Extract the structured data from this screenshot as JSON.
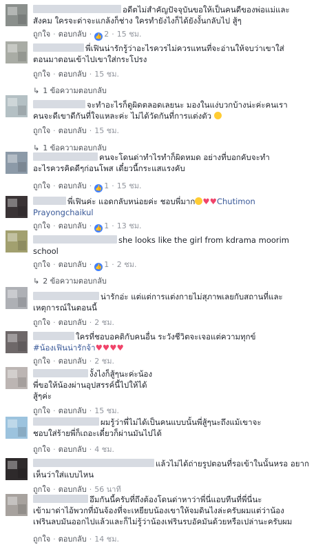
{
  "labels": {
    "like": "ถูกใจ",
    "reply": "ตอบกลับ",
    "separator": "·"
  },
  "colors": {
    "link": "#385898",
    "meta": "#90949c",
    "like_badge": "#4080ff"
  },
  "comments": [
    {
      "line1": "อดีตไม่สำคัญปัจจุบันขอให้เป็นคนดีของพ่อแม่และ",
      "line2": "สังคม ใครจะด่าจะแกล้งก็ช่าง ใครทำยังไงก็ได้ยังงั้นกลับไป สู้ๆ",
      "likes": "2",
      "time": "15 ชม."
    },
    {
      "line1": "พี่เฟินน่ารักรู้ว่าอะไรควรไม่ควรแทนที่จะอ่านให้จบว่าเขาใส่",
      "line2": "ตอนมาตอนเข้าไปเขาใส่กระโปรง",
      "time": "15 ชม.",
      "reply_text": "1 ข้อความตอบกลับ"
    },
    {
      "line1": "จะทำอะไรก็ดูผิดตลอดเลยนะ มองในแง่บวกบ้างน่ะค่ะคนเรา",
      "line2": "คนจะดีเขาดีกันที่ใจแหละค่ะ ไม่ได้วัดกันที่การแต่งตัว",
      "time": "15 ชม.",
      "reply_text": "1 ข้อความตอบกลับ"
    },
    {
      "line1": "คนจะโดนด่าทำไรทำก็ผิดหมด อย่างที่บอกคับจะทำ",
      "line2": "อะไรควรคิดดีๆก่อนโพส เดี๋ยวนี้กระแสแรงคับ",
      "likes": "1",
      "time": "15 ชม."
    },
    {
      "line1": "พี่เฟินค่ะ แอดกลับหน่อยค่ะ ชอบพี่มาก",
      "line1b": "Chutimon",
      "line2": "Prayongchaikul",
      "likes": "1",
      "time": "13 ชม."
    },
    {
      "line1": "she looks like the girl from kdrama moorim",
      "line2": "school",
      "likes": "1",
      "time": "2 ชม.",
      "reply_text": "2 ข้อความตอบกลับ"
    },
    {
      "line1": "น่ารักอ่ะ แต่แต่การแต่งกายไม่สุภาพเลยกับสถานที่และ",
      "line2": "เหตุการณ์ในตอนนี้",
      "time": "2 ชม."
    },
    {
      "line1": "ใครที่ชอบอคติกับคนอื่น ระวังชีวิตจะเจอแต่ความทุกข์",
      "line2": "#น้องเฟินน่ารักจ้า",
      "time": "2 ชม."
    },
    {
      "line1": "งั้งไงก็สู้ๆนะค่ะน้อง",
      "line2": "พี่ขอให้น้องผ่านอุปสรรค์นี้ไปให้ได้",
      "line3": "สู้ๆค่ะ",
      "time": "15 ชม."
    },
    {
      "line1": "ผมรู้ว่าพี่ไม่ได้เป็นคนแบบนั้นพี่สู้ๆนะถึงแม้เขาจะ",
      "line2": "ชอบใส่ร้ายพี่ก็เถอะเดี๋ยวก็ผ่านมันไปได้",
      "time": "4 ชม."
    },
    {
      "line1": "แล้วไม่ได้ถ่ายรูปตอนที่รอเข้าในนั้นหรอ อยาก",
      "line2": "เห็นว่าใส่แบบไหน",
      "time": "56 นาที"
    },
    {
      "line1": "อึมกันนี้ครับที่ถึงต้องโดนด่าหาว่าพี่นี่แอบทีนที่พี่นี่นะ",
      "line2": "เข้ามาด่าไอ้พวกที่มันจ้องที่จะเหยียบน้องเขาให้จมดินไงล่ะครับผมแต่ว่าน้อง",
      "line3": "เฟรินลบมันออกไปแล้วและก็ไม่รู้ว่าน้องเฟรินรบอัคมันด้วยหรือเปล่านะครับผม",
      "time": "14 ชม."
    }
  ]
}
